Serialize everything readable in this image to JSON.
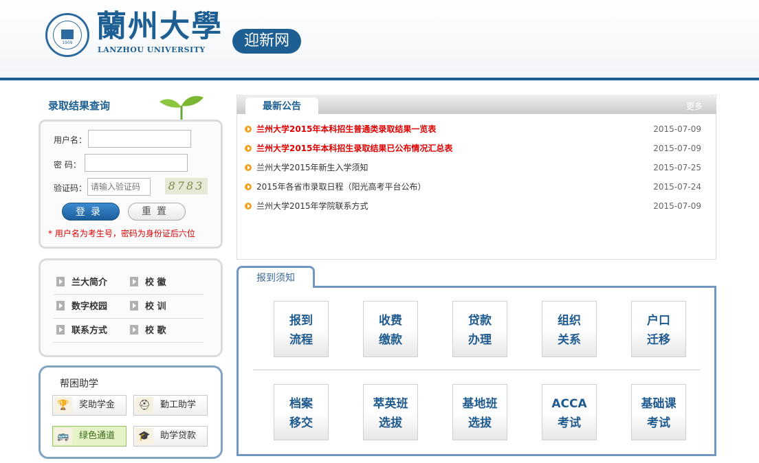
{
  "header": {
    "logo_cn": "蘭州大學",
    "logo_en": "LANZHOU UNIVERSITY",
    "seal_year": "1909",
    "site_name": "迎新网"
  },
  "login": {
    "title": "录取结果查询",
    "username_label": "用户名：",
    "password_label": "密 码：",
    "captcha_label": "验证码：",
    "captcha_placeholder": "请输入验证码",
    "captcha_value": "8783",
    "login_button": "登录",
    "reset_button": "重置",
    "note": "* 用户名为考生号，密码为身份证后六位"
  },
  "links": [
    {
      "label": "兰大简介"
    },
    {
      "label": "校 徽"
    },
    {
      "label": "数字校园"
    },
    {
      "label": "校 训"
    },
    {
      "label": "联系方式"
    },
    {
      "label": "校 歌"
    }
  ],
  "aid": {
    "title": "帮困助学",
    "items": [
      {
        "label": "奖助学金",
        "icon": "trophy-icon",
        "glyph": "🏆"
      },
      {
        "label": "勤工助学",
        "icon": "helmet-icon",
        "glyph": "⛑"
      },
      {
        "label": "绿色通道",
        "icon": "bus-icon",
        "glyph": "🚌"
      },
      {
        "label": "助学贷款",
        "icon": "graduate-icon",
        "glyph": "🎓"
      }
    ]
  },
  "announcements": {
    "tab": "最新公告",
    "more": "更多",
    "items": [
      {
        "title": "兰州大学2015年本科招生普通类录取结果一览表",
        "date": "2015-07-09",
        "hot": true
      },
      {
        "title": "兰州大学2015年本科招生录取结果已公布情况汇总表",
        "date": "2015-07-09",
        "hot": true
      },
      {
        "title": "兰州大学2015年新生入学须知",
        "date": "2015-07-25",
        "hot": false
      },
      {
        "title": "2015年各省市录取日程（阳光高考平台公布）",
        "date": "2015-07-24",
        "hot": false
      },
      {
        "title": "兰州大学2015年学院联系方式",
        "date": "2015-07-09",
        "hot": false
      }
    ]
  },
  "notice": {
    "tab": "报到须知",
    "tiles": [
      {
        "text": "报到\n流程"
      },
      {
        "text": "收费\n缴款"
      },
      {
        "text": "贷款\n办理"
      },
      {
        "text": "组织\n关系"
      },
      {
        "text": "户口\n迁移"
      },
      {
        "text": "档案\n移交"
      },
      {
        "text": "萃英班\n选拔"
      },
      {
        "text": "基地班\n选拔"
      },
      {
        "text": "ACCA\n考试"
      },
      {
        "text": "基础课\n考试"
      }
    ]
  },
  "colors": {
    "brand": "#1d5f92",
    "hot_text": "#dd0000",
    "bullet": "#f0a21e"
  }
}
